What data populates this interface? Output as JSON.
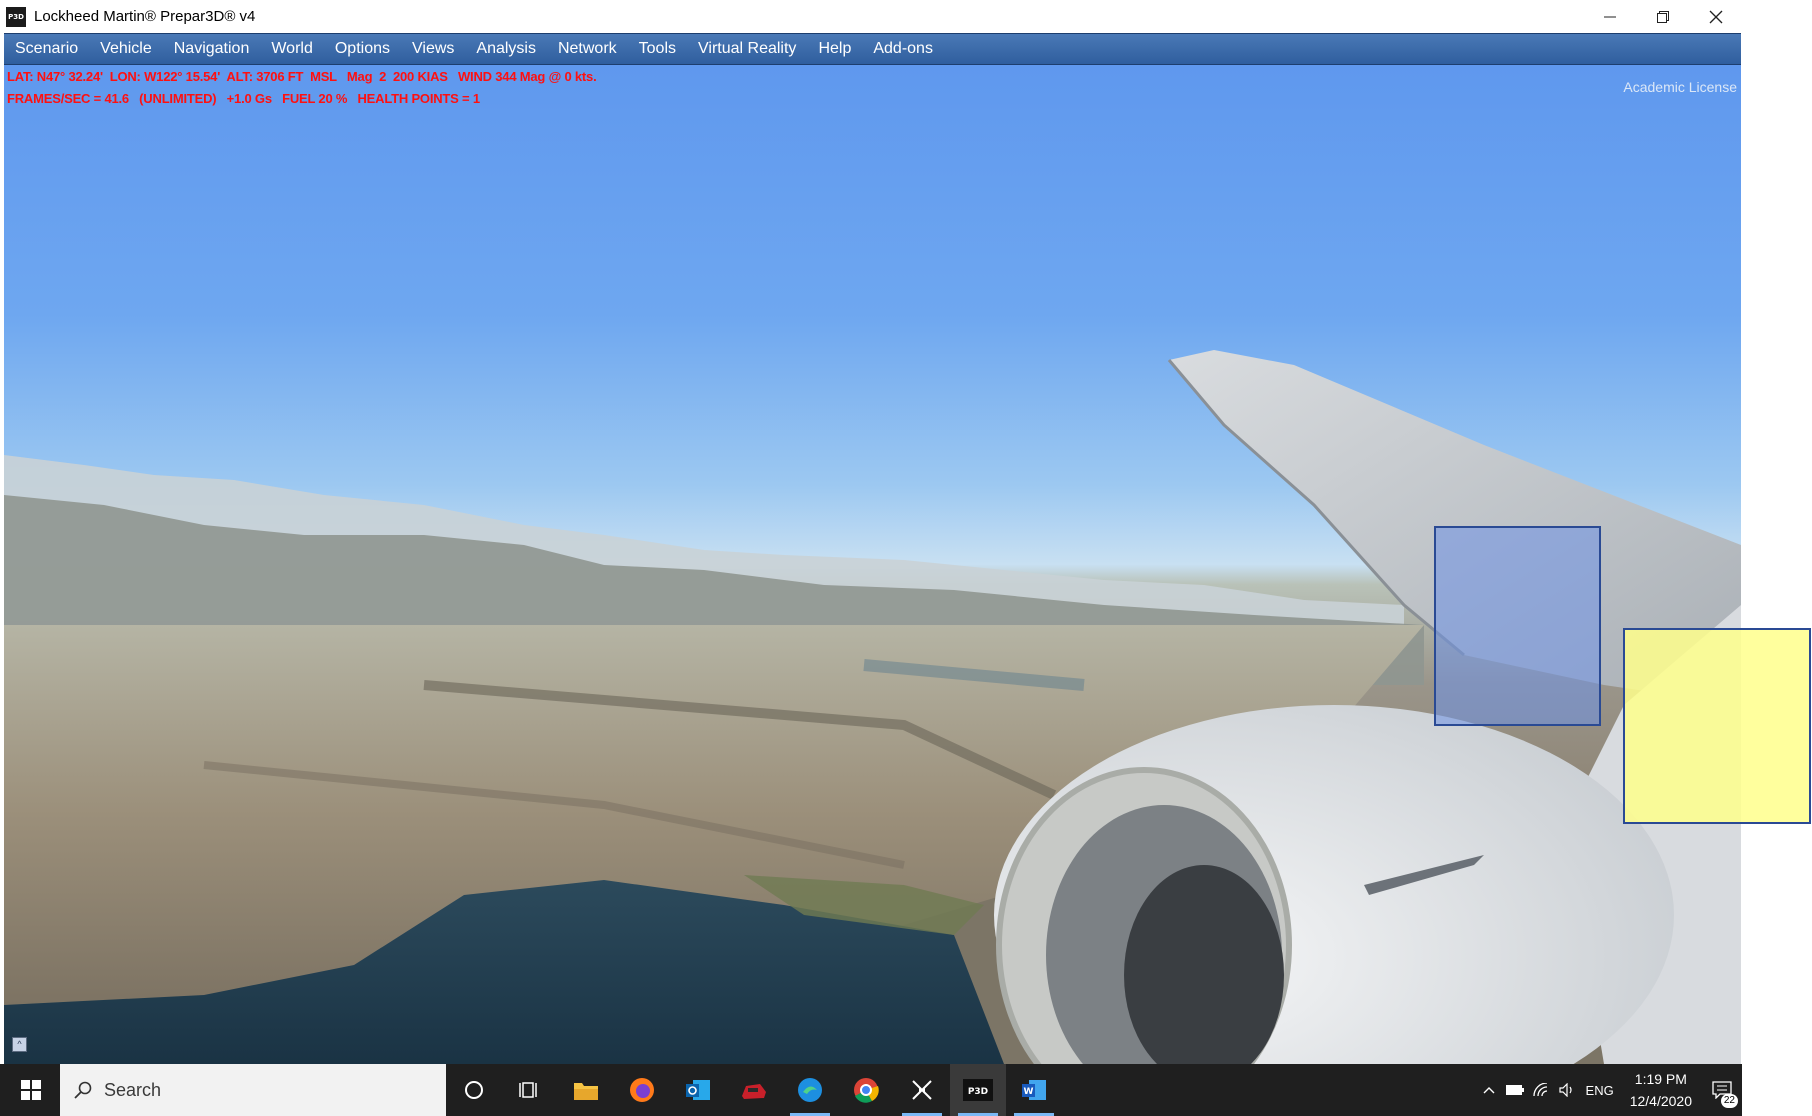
{
  "window": {
    "title": "Lockheed Martin® Prepar3D® v4",
    "app_icon_text": "P3D"
  },
  "menu": [
    {
      "label": "Scenario"
    },
    {
      "label": "Vehicle"
    },
    {
      "label": "Navigation"
    },
    {
      "label": "World"
    },
    {
      "label": "Options"
    },
    {
      "label": "Views"
    },
    {
      "label": "Analysis"
    },
    {
      "label": "Network"
    },
    {
      "label": "Tools"
    },
    {
      "label": "Virtual Reality"
    },
    {
      "label": "Help"
    },
    {
      "label": "Add-ons"
    }
  ],
  "hud": {
    "line1": "LAT: N47° 32.24'  LON: W122° 15.54'  ALT: 3706 FT  MSL   Mag  2  200 KIAS   WIND 344 Mag @ 0 kts.",
    "line2": "FRAMES/SEC = 41.6   (UNLIMITED)   +1.0 Gs   FUEL 20 %   HEALTH POINTS = 1",
    "license": "Academic License"
  },
  "taskbar": {
    "search_placeholder": "Search",
    "tray": {
      "language": "ENG",
      "time": "1:19 PM",
      "date": "12/4/2020",
      "notification_count": "22"
    }
  },
  "colors": {
    "menu_bg": "#3a6aa8",
    "hud_text": "#ff1010",
    "overlay_blue": "#6e91e6",
    "overlay_yellow": "#ffff8c"
  }
}
